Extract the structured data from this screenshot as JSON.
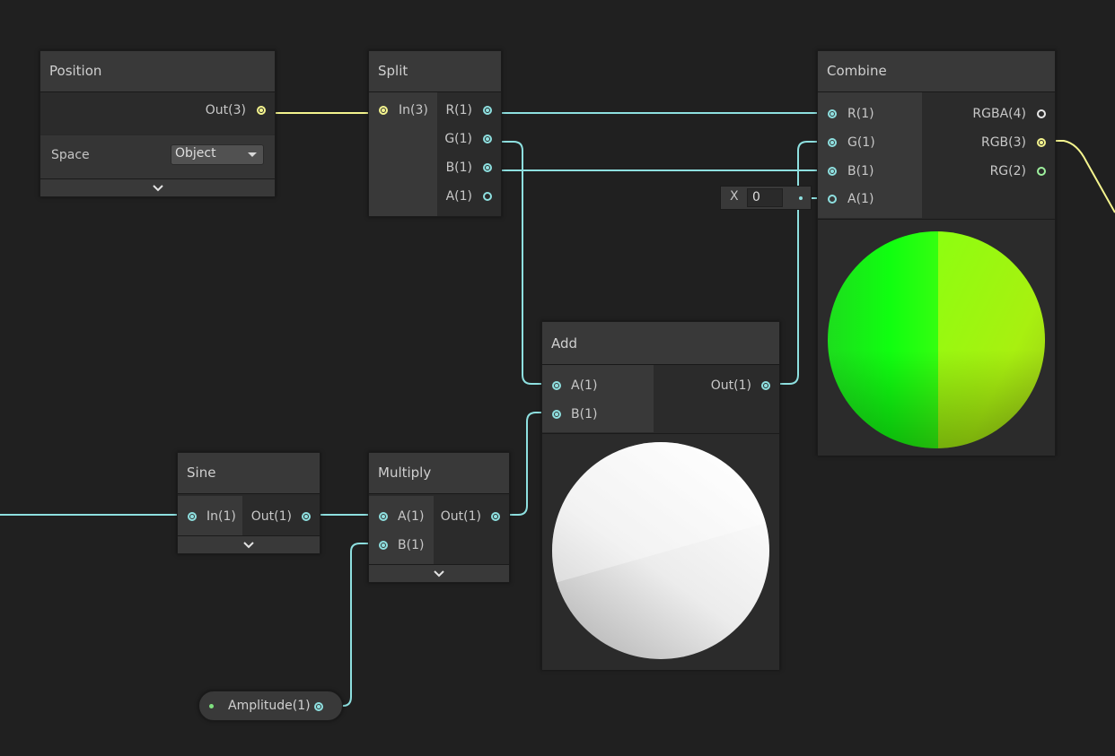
{
  "colors": {
    "background": "#202020",
    "wire_vector1": "#8ee0e0",
    "wire_vector3": "#f4f48e"
  },
  "position_node": {
    "title": "Position",
    "out_label": "Out(3)",
    "space_label": "Space",
    "space_value": "Object",
    "chevron": "⌄"
  },
  "split_node": {
    "title": "Split",
    "in_label": "In(3)",
    "outputs": [
      "R(1)",
      "G(1)",
      "B(1)",
      "A(1)"
    ]
  },
  "combine_node": {
    "title": "Combine",
    "inputs": [
      "R(1)",
      "G(1)",
      "B(1)",
      "A(1)"
    ],
    "outputs": [
      "RGBA(4)",
      "RGB(3)",
      "RG(2)"
    ],
    "default_a_label": "X",
    "default_a_value": "0"
  },
  "add_node": {
    "title": "Add",
    "inputs": [
      "A(1)",
      "B(1)"
    ],
    "out_label": "Out(1)"
  },
  "sine_node": {
    "title": "Sine",
    "in_label": "In(1)",
    "out_label": "Out(1)",
    "chevron": "⌄"
  },
  "multiply_node": {
    "title": "Multiply",
    "inputs": [
      "A(1)",
      "B(1)"
    ],
    "out_label": "Out(1)",
    "chevron": "⌄"
  },
  "amplitude_property": {
    "label": "Amplitude(1)"
  }
}
